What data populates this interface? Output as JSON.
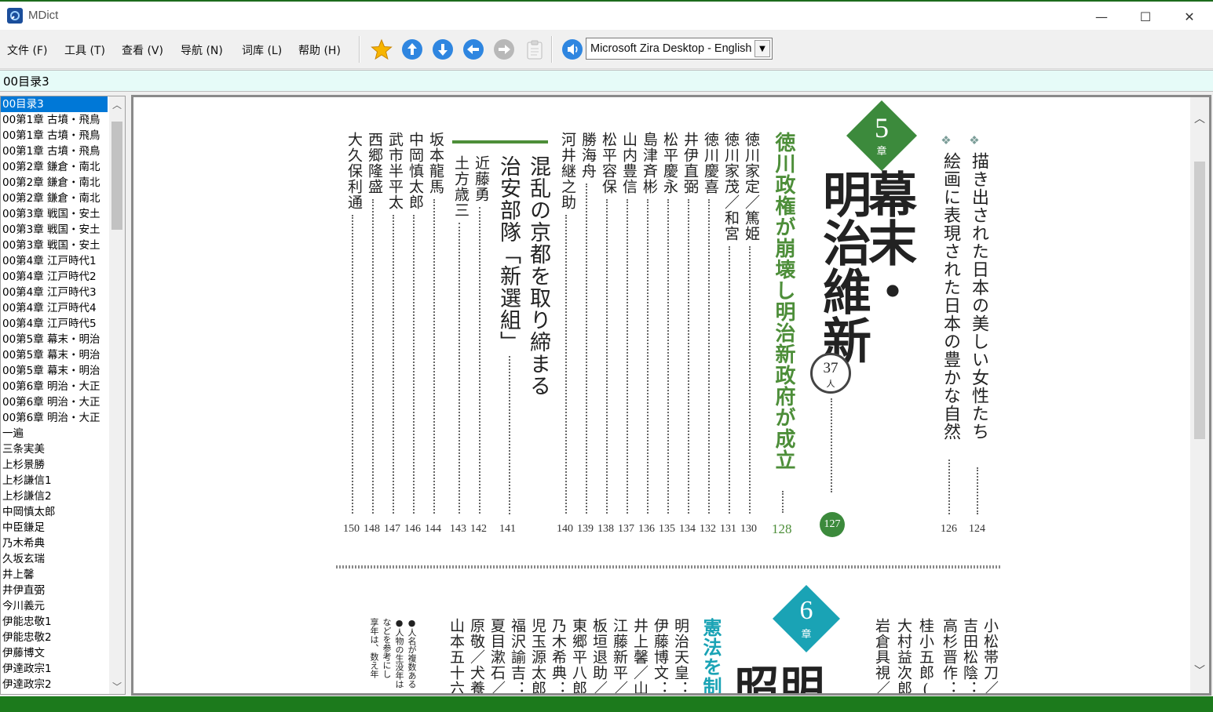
{
  "window": {
    "title": "MDict",
    "min_label": "—",
    "max_label": "☐",
    "close_label": "✕"
  },
  "menu": [
    {
      "label": "文件 (F)"
    },
    {
      "label": "工具 (T)"
    },
    {
      "label": "查看 (V)"
    },
    {
      "label": "导航 (N)"
    },
    {
      "label": "词库 (L)"
    },
    {
      "label": "帮助 (H)"
    }
  ],
  "toolbar": {
    "icons": [
      "favorite-star-icon",
      "up-arrow-icon",
      "down-arrow-icon",
      "back-arrow-icon",
      "forward-arrow-icon",
      "clipboard-icon",
      "speaker-icon"
    ],
    "tts_voice": "Microsoft Zira Desktop - English"
  },
  "search": {
    "value": "00目录3"
  },
  "sidebar": {
    "entries": [
      "00目录3",
      "00第1章 古墳・飛鳥",
      "00第1章 古墳・飛鳥",
      "00第1章 古墳・飛鳥",
      "00第2章 鎌倉・南北",
      "00第2章 鎌倉・南北",
      "00第2章 鎌倉・南北",
      "00第3章 戦国・安土",
      "00第3章 戦国・安土",
      "00第3章 戦国・安土",
      "00第4章 江戸時代1",
      "00第4章 江戸時代2",
      "00第4章 江戸時代3",
      "00第4章 江戸時代4",
      "00第4章 江戸時代5",
      "00第5章 幕末・明治",
      "00第5章 幕末・明治",
      "00第5章 幕末・明治",
      "00第6章 明治・大正",
      "00第6章 明治・大正",
      "00第6章 明治・大正",
      "一遍",
      "三条実美",
      "上杉景勝",
      "上杉謙信1",
      "上杉謙信2",
      "中岡慎太郎",
      "中臣鎌足",
      "乃木希典",
      "久坂玄瑞",
      "井上馨",
      "井伊直弼",
      "今川義元",
      "伊能忠敬1",
      "伊能忠敬2",
      "伊藤博文",
      "伊達政宗1",
      "伊達政宗2"
    ]
  },
  "content": {
    "ch5": {
      "num": "5",
      "label": "章",
      "title1": "幕末・",
      "title2": "明治維新",
      "count_num": "37",
      "count_unit": "人",
      "count_page": "127",
      "subtitle": "徳川政権が崩壊し明治新政府が成立",
      "subtitle_page": "128"
    },
    "art_bullets": "❖",
    "art": [
      {
        "text": "描き出された日本の美しい女性たち",
        "page": "124"
      },
      {
        "text": "絵画に表現された日本の豊かな自然",
        "page": "126"
      }
    ],
    "people_a": [
      {
        "name": "徳川家定／篤姫",
        "page": "130"
      },
      {
        "name": "徳川家茂／和宮",
        "page": "131"
      },
      {
        "name": "徳川慶喜",
        "page": "132"
      },
      {
        "name": "井伊直弼",
        "page": "134"
      },
      {
        "name": "松平慶永",
        "page": "135"
      },
      {
        "name": "島津斉彬",
        "page": "136"
      },
      {
        "name": "山内豊信",
        "page": "137"
      },
      {
        "name": "松平容保",
        "page": "138"
      },
      {
        "name": "勝海舟",
        "page": "139"
      },
      {
        "name": "河井継之助",
        "page": "140"
      }
    ],
    "shinsengumi": {
      "title1": "混乱の京都を取り締まる",
      "title2": "治安部隊「新選組」",
      "page": "141"
    },
    "people_b": [
      {
        "name": "近藤勇",
        "page": "142"
      },
      {
        "name": "土方歳三",
        "page": "143"
      }
    ],
    "people_c": [
      {
        "name": "坂本龍馬",
        "page": "144"
      },
      {
        "name": "中岡慎太郎",
        "page": "146"
      },
      {
        "name": "武市半平太",
        "page": "147"
      },
      {
        "name": "西郷隆盛",
        "page": "148"
      },
      {
        "name": "大久保利通",
        "page": "150"
      }
    ],
    "ch6": {
      "num": "6",
      "label": "章",
      "title_a": "明",
      "title_b": "昭",
      "sub": "憲法を制"
    },
    "people_d": [
      "小松帯刀／",
      "吉田松陰：",
      "高杉晋作：",
      "桂小五郎(木",
      "大村益次郎",
      "岩倉具視／"
    ],
    "people_e": [
      "明治天皇：",
      "伊藤博文：",
      "井上馨／山",
      "江藤新平／",
      "板垣退助／",
      "東郷平八郎",
      "乃木希典：",
      "児玉源太郎",
      "福沢諭吉：",
      "夏目漱石／",
      "原敬／犬養",
      "山本五十六"
    ],
    "notes": [
      "●人名が複数ある",
      "●人物の生没年は",
      "などを参考にし",
      "享年は、数え年"
    ]
  }
}
